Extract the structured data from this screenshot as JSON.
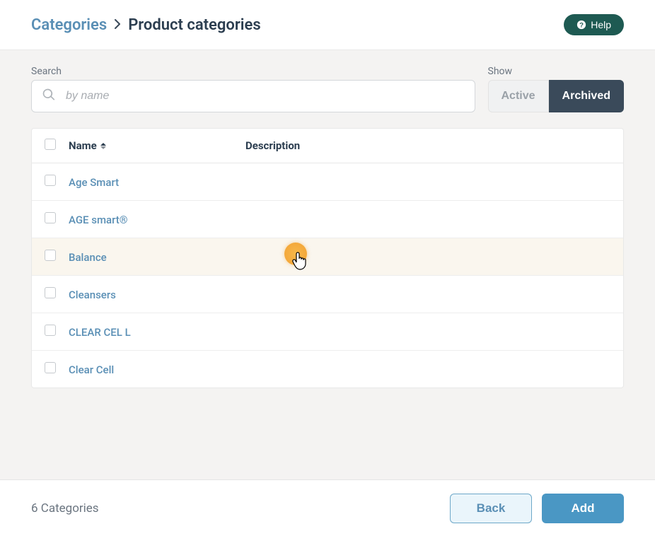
{
  "breadcrumb": {
    "root": "Categories",
    "current": "Product categories"
  },
  "help_label": "Help",
  "search": {
    "label": "Search",
    "placeholder": "by name",
    "value": ""
  },
  "show": {
    "label": "Show",
    "active_label": "Active",
    "archived_label": "Archived",
    "selected": "archived"
  },
  "table": {
    "columns": {
      "name": "Name",
      "description": "Description"
    },
    "rows": [
      {
        "name": "Age Smart",
        "description": "",
        "highlighted": false
      },
      {
        "name": "AGE smart®",
        "description": "",
        "highlighted": false
      },
      {
        "name": "Balance",
        "description": "",
        "highlighted": true
      },
      {
        "name": "Cleansers",
        "description": "",
        "highlighted": false
      },
      {
        "name": "CLEAR CEL L",
        "description": "",
        "highlighted": false
      },
      {
        "name": "Clear Cell",
        "description": "",
        "highlighted": false
      }
    ]
  },
  "footer": {
    "count_text": "6 Categories",
    "back_label": "Back",
    "add_label": "Add"
  }
}
